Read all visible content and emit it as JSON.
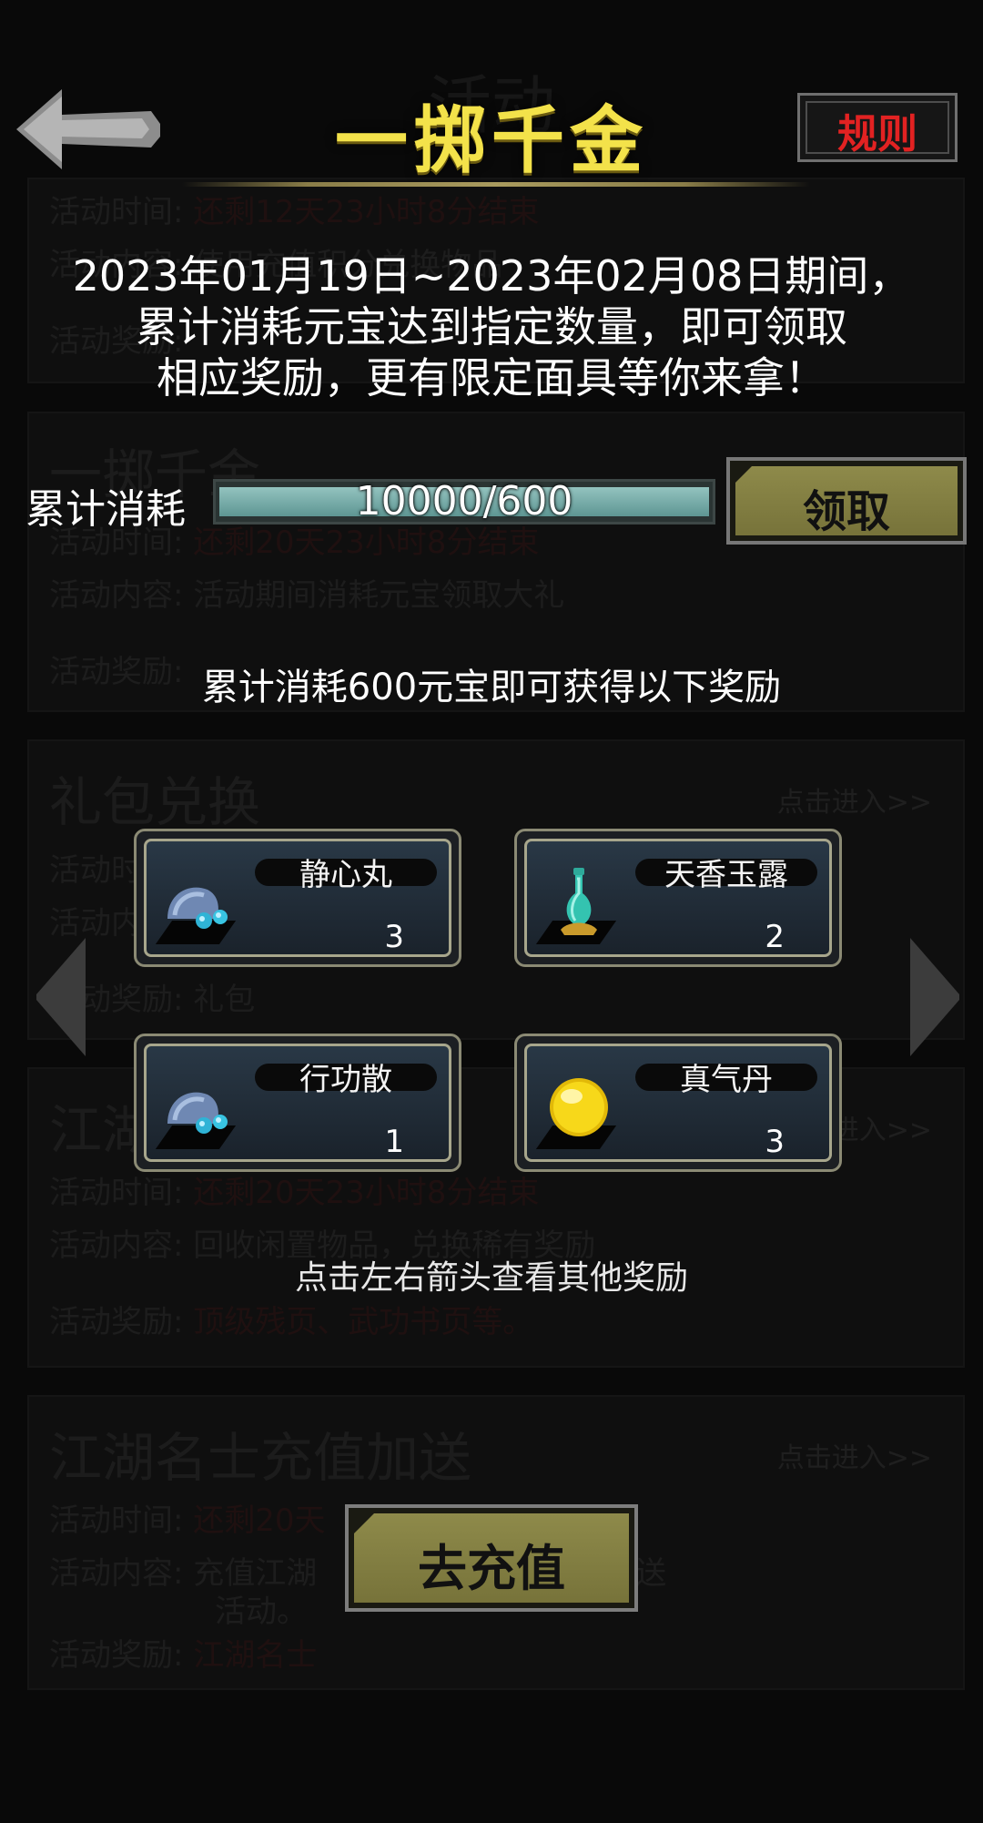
{
  "header": {
    "title": "一掷千金",
    "rules_label": "规则"
  },
  "popup": {
    "description_lines": [
      "2023年01月19日~2023年02月08日期间，",
      "累计消耗元宝达到指定数量，即可领取",
      "相应奖励，更有限定面具等你来拿！"
    ],
    "progress": {
      "label": "累计消耗",
      "text": "10000/600",
      "fill_fraction": 1.0
    },
    "claim_label": "领取",
    "reward_caption": "累计消耗600元宝即可获得以下奖励",
    "rewards": [
      {
        "name": "静心丸",
        "count": "3",
        "icon": "blue-pill-icon"
      },
      {
        "name": "天香玉露",
        "count": "2",
        "icon": "jade-vase-icon"
      },
      {
        "name": "行功散",
        "count": "1",
        "icon": "blue-pill-icon"
      },
      {
        "name": "真气丹",
        "count": "3",
        "icon": "gold-orb-icon"
      }
    ],
    "hint": "点击左右箭头查看其他奖励",
    "recharge_label": "去充值"
  },
  "background": {
    "header_ghost": "活动",
    "field_labels": {
      "time": "活动时间:",
      "content": "活动内容:",
      "reward": "活动奖励:"
    },
    "enter_link": "点击进入>>",
    "cards": [
      {
        "title": "",
        "time": "还剩12天23小时8分结束",
        "content": "使用充值积分兑换物品",
        "reward": ""
      },
      {
        "title": "一掷千金",
        "time": "还剩20天23小时8分结束",
        "content": "活动期间消耗元宝领取大礼",
        "reward": ""
      },
      {
        "title": "礼包兑换",
        "time": "",
        "content": "",
        "reward": "礼包"
      },
      {
        "title": "江湖",
        "time": "还剩20天23小时8分结束",
        "content": "回收闲置物品，兑换稀有奖励",
        "reward": "顶级残页、武功书页等。"
      },
      {
        "title": "江湖名士充值加送",
        "time": "还剩20天",
        "content": "充值江湖",
        "content2": "即可参与加送",
        "content3": "活动。",
        "reward": "江湖名士"
      }
    ]
  },
  "colors": {
    "title_yellow": "#f3e24a",
    "rules_red": "#e22222",
    "olive_button": "#8e8a4a",
    "progress_teal": "#7fb3af"
  }
}
